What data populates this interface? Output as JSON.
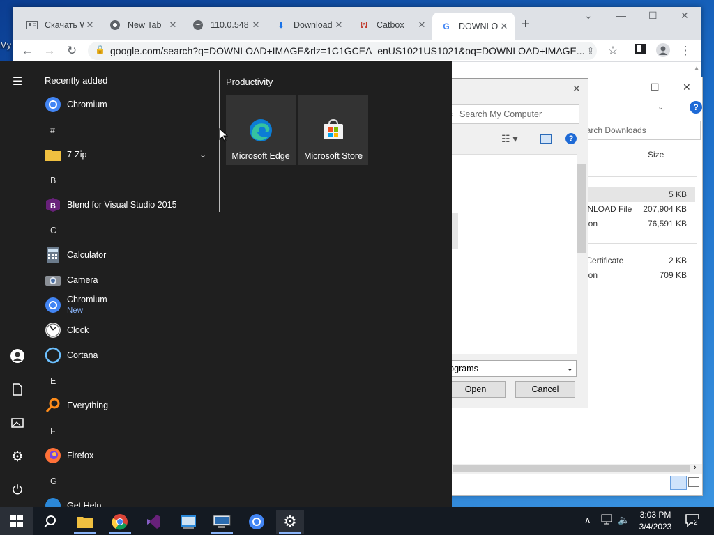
{
  "desktop": {
    "icon_label": "My"
  },
  "browser": {
    "tabs": [
      {
        "title": "Скачать W",
        "icon": "document-icon"
      },
      {
        "title": "New Tab",
        "icon": "chrome-icon"
      },
      {
        "title": "110.0.548",
        "icon": "globe-icon"
      },
      {
        "title": "Download",
        "icon": "download-icon"
      },
      {
        "title": "Catbox",
        "icon": "catbox-icon"
      },
      {
        "title": "DOWNLO",
        "icon": "google-icon"
      }
    ],
    "new_tab_label": "+",
    "url": "google.com/search?q=DOWNLOAD+IMAGE&rlz=1C1GCEA_enUS1021US1021&oq=DOWNLOAD+IMAGE..."
  },
  "explorer": {
    "search_placeholder": "earch Downloads",
    "size_header": "Size",
    "rows": [
      {
        "name": "e",
        "size": "5 KB"
      },
      {
        "name": "WNLOAD File",
        "size": "207,904 KB"
      },
      {
        "name": "ation",
        "size": "76,591 KB"
      },
      {
        "name": "",
        "size": ""
      },
      {
        "name": "y Certificate",
        "size": "2 KB"
      },
      {
        "name": "ation",
        "size": "709 KB"
      }
    ]
  },
  "dialog": {
    "search_placeholder": "Search My Computer",
    "filter_value": "rograms",
    "open_label": "Open",
    "cancel_label": "Cancel"
  },
  "start_menu": {
    "recently_added_label": "Recently added",
    "tiles_group": "Productivity",
    "tiles": [
      {
        "label": "Microsoft Edge",
        "icon": "edge-icon"
      },
      {
        "label": "Microsoft Store",
        "icon": "store-icon"
      }
    ],
    "apps": [
      {
        "label": "Chromium",
        "icon": "chromium-icon"
      },
      {
        "letter": "#"
      },
      {
        "label": "7-Zip",
        "icon": "folder-icon"
      },
      {
        "letter": "B"
      },
      {
        "label": "Blend for Visual Studio 2015",
        "icon": "blend-icon"
      },
      {
        "letter": "C"
      },
      {
        "label": "Calculator",
        "icon": "calculator-icon"
      },
      {
        "label": "Camera",
        "icon": "camera-icon"
      },
      {
        "label": "Chromium",
        "sub": "New",
        "icon": "chromium-icon"
      },
      {
        "label": "Clock",
        "icon": "clock-icon"
      },
      {
        "label": "Cortana",
        "icon": "cortana-icon"
      },
      {
        "letter": "E"
      },
      {
        "label": "Everything",
        "icon": "search-icon"
      },
      {
        "letter": "F"
      },
      {
        "label": "Firefox",
        "icon": "firefox-icon"
      },
      {
        "letter": "G"
      },
      {
        "label": "Get Help",
        "icon": "help-icon"
      }
    ]
  },
  "taskbar": {
    "time": "3:03 PM",
    "date": "3/4/2023",
    "notification_count": "2"
  }
}
